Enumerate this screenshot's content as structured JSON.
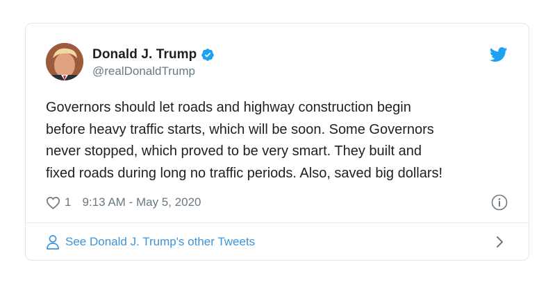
{
  "tweet": {
    "display_name": "Donald J. Trump",
    "handle": "@realDonaldTrump",
    "text": "Governors should let roads and highway construction begin\nbefore heavy traffic starts, which will be soon. Some Governors\nnever stopped, which proved to be very smart. They built and\nfixed roads during long no traffic periods. Also, saved big dollars!",
    "like_count": "1",
    "timestamp": "9:13 AM - May 5, 2020",
    "footer_link": "See Donald J. Trump's other Tweets"
  },
  "icons": {
    "verified": "verified-badge-icon",
    "brand": "twitter-bird-icon",
    "like": "heart-icon",
    "info": "info-icon",
    "profile": "person-icon",
    "chevron": "chevron-right-icon"
  },
  "colors": {
    "brand_blue": "#1da1f2",
    "link_blue": "#3b94d9",
    "text": "#1c2022",
    "secondary_text": "#697882",
    "border": "#e1e8ed"
  }
}
